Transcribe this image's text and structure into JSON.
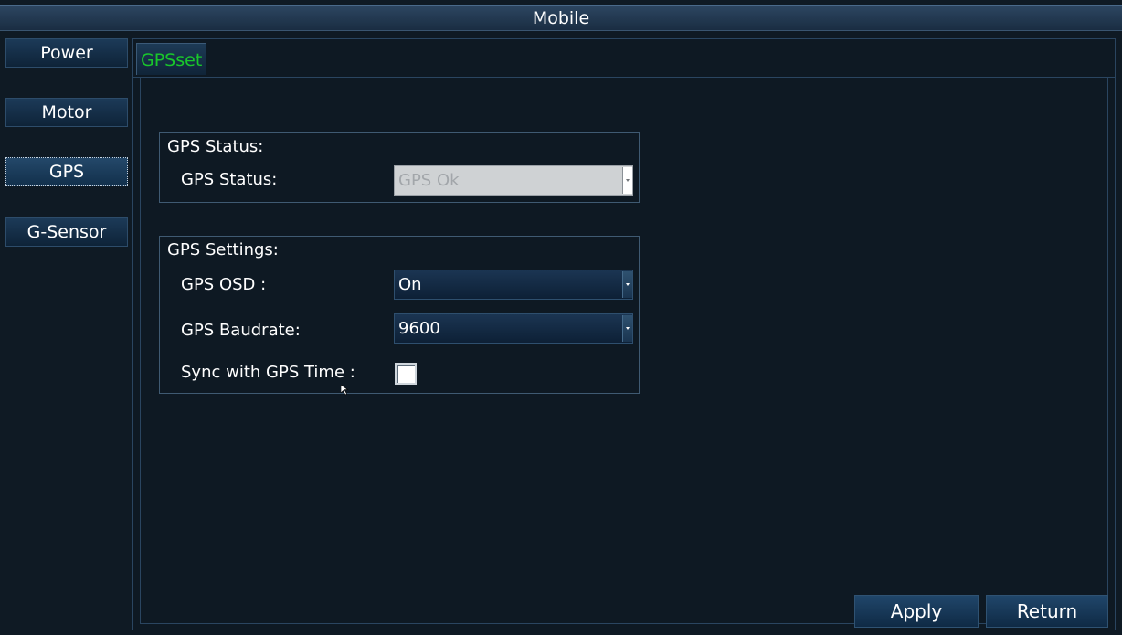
{
  "window": {
    "title": "Mobile"
  },
  "sidebar": {
    "items": [
      {
        "label": "Power"
      },
      {
        "label": "Motor"
      },
      {
        "label": "GPS"
      },
      {
        "label": "G-Sensor"
      }
    ],
    "active": "GPS"
  },
  "tabs": [
    {
      "label": "GPSset",
      "color": "#19c72b"
    }
  ],
  "gps_status": {
    "group_title": "GPS Status:",
    "status_label": "GPS Status:",
    "status_value": "GPS Ok"
  },
  "gps_settings": {
    "group_title": "GPS Settings:",
    "osd_label": "GPS OSD :",
    "osd_value": "On",
    "baudrate_label": "GPS Baudrate:",
    "baudrate_value": "9600",
    "sync_label": "Sync with GPS Time :",
    "sync_checked": false
  },
  "actions": {
    "apply_label": "Apply",
    "return_label": "Return"
  },
  "colors": {
    "background": "#0f1a24",
    "tab_text": "#19c72b",
    "button": "#1c3a58"
  }
}
